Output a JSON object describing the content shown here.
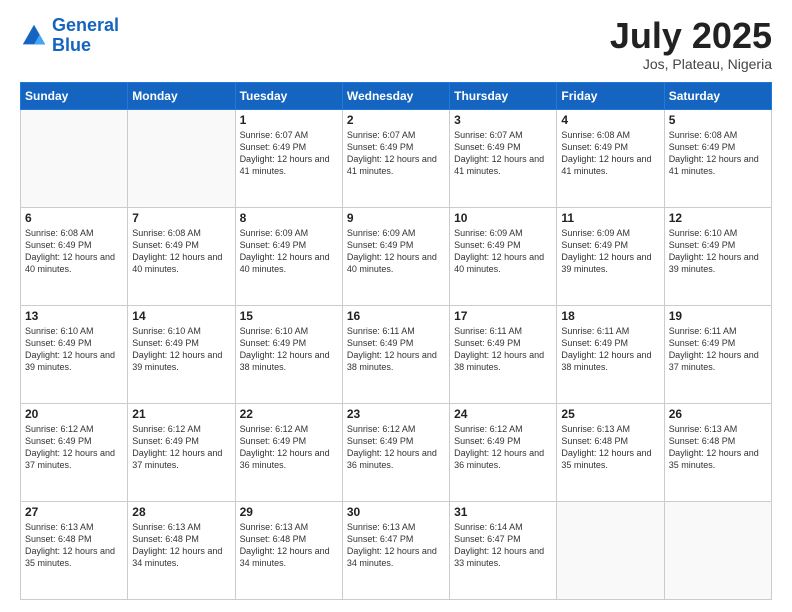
{
  "header": {
    "logo_line1": "General",
    "logo_line2": "Blue",
    "month": "July 2025",
    "location": "Jos, Plateau, Nigeria"
  },
  "weekdays": [
    "Sunday",
    "Monday",
    "Tuesday",
    "Wednesday",
    "Thursday",
    "Friday",
    "Saturday"
  ],
  "weeks": [
    [
      {
        "day": "",
        "info": ""
      },
      {
        "day": "",
        "info": ""
      },
      {
        "day": "1",
        "info": "Sunrise: 6:07 AM\nSunset: 6:49 PM\nDaylight: 12 hours\nand 41 minutes."
      },
      {
        "day": "2",
        "info": "Sunrise: 6:07 AM\nSunset: 6:49 PM\nDaylight: 12 hours\nand 41 minutes."
      },
      {
        "day": "3",
        "info": "Sunrise: 6:07 AM\nSunset: 6:49 PM\nDaylight: 12 hours\nand 41 minutes."
      },
      {
        "day": "4",
        "info": "Sunrise: 6:08 AM\nSunset: 6:49 PM\nDaylight: 12 hours\nand 41 minutes."
      },
      {
        "day": "5",
        "info": "Sunrise: 6:08 AM\nSunset: 6:49 PM\nDaylight: 12 hours\nand 41 minutes."
      }
    ],
    [
      {
        "day": "6",
        "info": "Sunrise: 6:08 AM\nSunset: 6:49 PM\nDaylight: 12 hours\nand 40 minutes."
      },
      {
        "day": "7",
        "info": "Sunrise: 6:08 AM\nSunset: 6:49 PM\nDaylight: 12 hours\nand 40 minutes."
      },
      {
        "day": "8",
        "info": "Sunrise: 6:09 AM\nSunset: 6:49 PM\nDaylight: 12 hours\nand 40 minutes."
      },
      {
        "day": "9",
        "info": "Sunrise: 6:09 AM\nSunset: 6:49 PM\nDaylight: 12 hours\nand 40 minutes."
      },
      {
        "day": "10",
        "info": "Sunrise: 6:09 AM\nSunset: 6:49 PM\nDaylight: 12 hours\nand 40 minutes."
      },
      {
        "day": "11",
        "info": "Sunrise: 6:09 AM\nSunset: 6:49 PM\nDaylight: 12 hours\nand 39 minutes."
      },
      {
        "day": "12",
        "info": "Sunrise: 6:10 AM\nSunset: 6:49 PM\nDaylight: 12 hours\nand 39 minutes."
      }
    ],
    [
      {
        "day": "13",
        "info": "Sunrise: 6:10 AM\nSunset: 6:49 PM\nDaylight: 12 hours\nand 39 minutes."
      },
      {
        "day": "14",
        "info": "Sunrise: 6:10 AM\nSunset: 6:49 PM\nDaylight: 12 hours\nand 39 minutes."
      },
      {
        "day": "15",
        "info": "Sunrise: 6:10 AM\nSunset: 6:49 PM\nDaylight: 12 hours\nand 38 minutes."
      },
      {
        "day": "16",
        "info": "Sunrise: 6:11 AM\nSunset: 6:49 PM\nDaylight: 12 hours\nand 38 minutes."
      },
      {
        "day": "17",
        "info": "Sunrise: 6:11 AM\nSunset: 6:49 PM\nDaylight: 12 hours\nand 38 minutes."
      },
      {
        "day": "18",
        "info": "Sunrise: 6:11 AM\nSunset: 6:49 PM\nDaylight: 12 hours\nand 38 minutes."
      },
      {
        "day": "19",
        "info": "Sunrise: 6:11 AM\nSunset: 6:49 PM\nDaylight: 12 hours\nand 37 minutes."
      }
    ],
    [
      {
        "day": "20",
        "info": "Sunrise: 6:12 AM\nSunset: 6:49 PM\nDaylight: 12 hours\nand 37 minutes."
      },
      {
        "day": "21",
        "info": "Sunrise: 6:12 AM\nSunset: 6:49 PM\nDaylight: 12 hours\nand 37 minutes."
      },
      {
        "day": "22",
        "info": "Sunrise: 6:12 AM\nSunset: 6:49 PM\nDaylight: 12 hours\nand 36 minutes."
      },
      {
        "day": "23",
        "info": "Sunrise: 6:12 AM\nSunset: 6:49 PM\nDaylight: 12 hours\nand 36 minutes."
      },
      {
        "day": "24",
        "info": "Sunrise: 6:12 AM\nSunset: 6:49 PM\nDaylight: 12 hours\nand 36 minutes."
      },
      {
        "day": "25",
        "info": "Sunrise: 6:13 AM\nSunset: 6:48 PM\nDaylight: 12 hours\nand 35 minutes."
      },
      {
        "day": "26",
        "info": "Sunrise: 6:13 AM\nSunset: 6:48 PM\nDaylight: 12 hours\nand 35 minutes."
      }
    ],
    [
      {
        "day": "27",
        "info": "Sunrise: 6:13 AM\nSunset: 6:48 PM\nDaylight: 12 hours\nand 35 minutes."
      },
      {
        "day": "28",
        "info": "Sunrise: 6:13 AM\nSunset: 6:48 PM\nDaylight: 12 hours\nand 34 minutes."
      },
      {
        "day": "29",
        "info": "Sunrise: 6:13 AM\nSunset: 6:48 PM\nDaylight: 12 hours\nand 34 minutes."
      },
      {
        "day": "30",
        "info": "Sunrise: 6:13 AM\nSunset: 6:47 PM\nDaylight: 12 hours\nand 34 minutes."
      },
      {
        "day": "31",
        "info": "Sunrise: 6:14 AM\nSunset: 6:47 PM\nDaylight: 12 hours\nand 33 minutes."
      },
      {
        "day": "",
        "info": ""
      },
      {
        "day": "",
        "info": ""
      }
    ]
  ]
}
